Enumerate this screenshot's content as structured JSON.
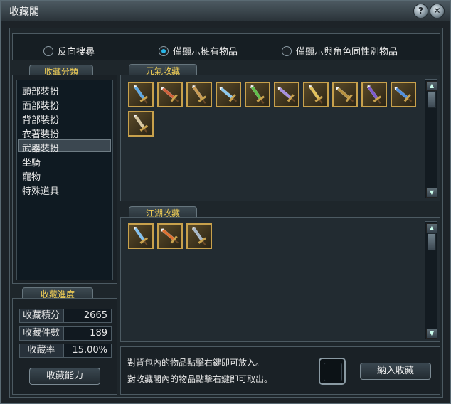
{
  "window": {
    "title": "收藏閣"
  },
  "titlebar": {
    "help_glyph": "?",
    "close_glyph": "✕"
  },
  "filters": [
    {
      "label": "反向搜尋",
      "selected": false
    },
    {
      "label": "僅顯示擁有物品",
      "selected": true
    },
    {
      "label": "僅顯示與角色同性別物品",
      "selected": false
    }
  ],
  "categories": {
    "header": "收藏分類",
    "items": [
      "頭部裝扮",
      "面部裝扮",
      "背部裝扮",
      "衣著裝扮",
      "武器裝扮",
      "坐騎",
      "寵物",
      "特殊道具"
    ],
    "selected": "武器裝扮"
  },
  "progress": {
    "header": "收藏進度",
    "stats": [
      {
        "label": "收藏積分",
        "value": "2665"
      },
      {
        "label": "收藏件數",
        "value": "189"
      },
      {
        "label": "收藏率",
        "value": "15.00%"
      }
    ],
    "ability_button": "收藏能力"
  },
  "yuanqi": {
    "header": "元氣收藏",
    "items": [
      {
        "icon": "blue-blade-weapon-icon",
        "color": "#5aa8e6"
      },
      {
        "icon": "red-blade-weapon-icon",
        "color": "#d0603a"
      },
      {
        "icon": "bronze-blade-weapon-icon",
        "color": "#c99a52"
      },
      {
        "icon": "ice-blade-weapon-icon",
        "color": "#8ac8f0"
      },
      {
        "icon": "green-blade-weapon-icon",
        "color": "#5fbf4a"
      },
      {
        "icon": "violet-blade-weapon-icon",
        "color": "#a58ee0"
      },
      {
        "icon": "golden-blade-weapon-icon",
        "color": "#e2c15a"
      },
      {
        "icon": "dark-gold-blade-weapon-icon",
        "color": "#b89240"
      },
      {
        "icon": "purple-blade-weapon-icon",
        "color": "#7a5ad0"
      },
      {
        "icon": "azure-blade-weapon-icon",
        "color": "#4f8fe0"
      },
      {
        "icon": "silver-gold-blade-weapon-icon",
        "color": "#d8c8a0"
      }
    ]
  },
  "jianghu": {
    "header": "江湖收藏",
    "items": [
      {
        "icon": "frost-sword-weapon-icon",
        "color": "#7fc0ef"
      },
      {
        "icon": "flame-blade-weapon-icon",
        "color": "#e07030"
      },
      {
        "icon": "jade-sword-weapon-icon",
        "color": "#a8b8c8"
      }
    ]
  },
  "bottom": {
    "hint_lines": [
      "對背包內的物品點擊右鍵即可放入。",
      "對收藏閣內的物品點擊右鍵即可取出。"
    ],
    "deposit_button": "納入收藏"
  }
}
